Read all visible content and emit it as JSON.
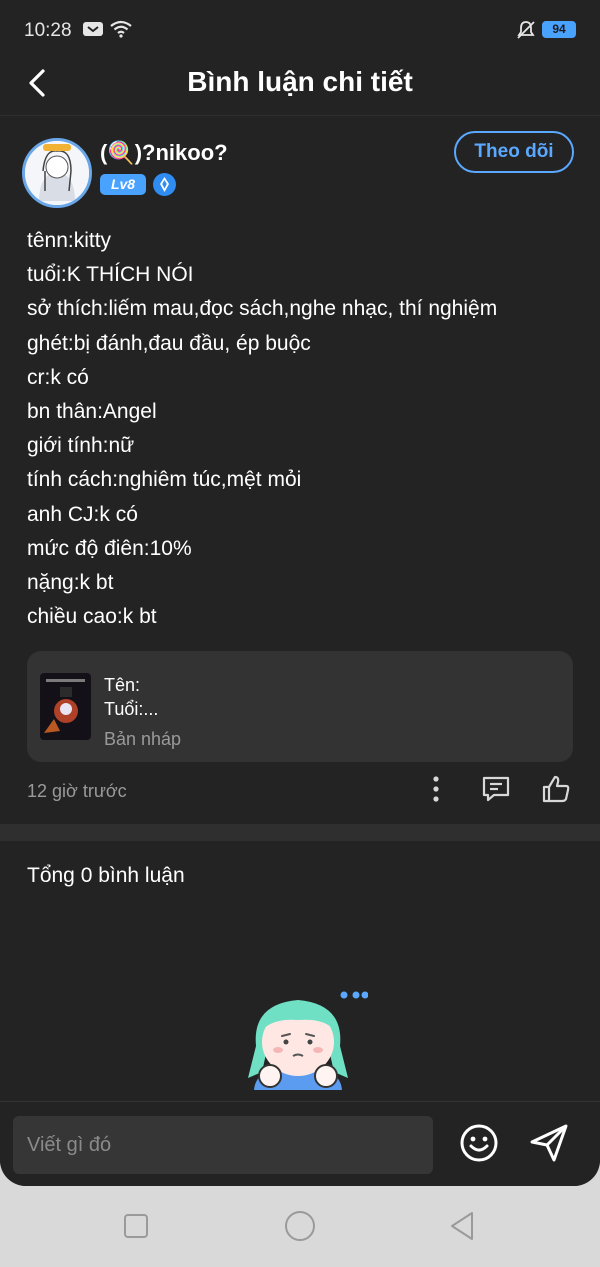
{
  "status_bar": {
    "time": "10:28",
    "battery": "94",
    "icons": [
      "message-icon",
      "wifi-icon",
      "mute-icon",
      "battery-icon"
    ]
  },
  "header": {
    "title": "Bình luận chi tiết",
    "back_icon": "chevron-left-icon"
  },
  "post": {
    "username": "(🍭)?nikoo?",
    "level_badge": "Lv8",
    "follow_label": "Theo dõi",
    "lines": [
      "tênn:kitty",
      "tuổi:K THÍCH NÓI",
      "sở thích:liếm mau,đọc sách,nghe nhạc, thí nghiệm",
      "ghét:bị đánh,đau đầu, ép buộc",
      "cr:k có",
      "bn thân:Angel",
      "giới tính:nữ",
      "tính cách:nghiêm túc,mệt mỏi",
      "anh CJ:k có",
      "mức độ điên:10%",
      "nặng:k bt",
      "chiều cao:k bt"
    ],
    "attachment": {
      "line1": "Tên:",
      "line2": "Tuổi:...",
      "status": "Bản nháp"
    },
    "time_ago": "12 giờ trước",
    "action_icons": [
      "more-vertical-icon",
      "comment-icon",
      "thumbs-up-icon"
    ]
  },
  "comments": {
    "total_label": "Tổng 0 bình luận"
  },
  "composer": {
    "placeholder": "Viết gì đó",
    "icons": [
      "emoji-icon",
      "send-icon"
    ]
  },
  "system_nav": {
    "icons": [
      "recent-apps-icon",
      "home-icon",
      "back-triangle-icon"
    ]
  },
  "colors": {
    "background": "#232323",
    "accent": "#5aa8ff",
    "secondary_text": "#9a9a9a",
    "card": "#333333"
  }
}
